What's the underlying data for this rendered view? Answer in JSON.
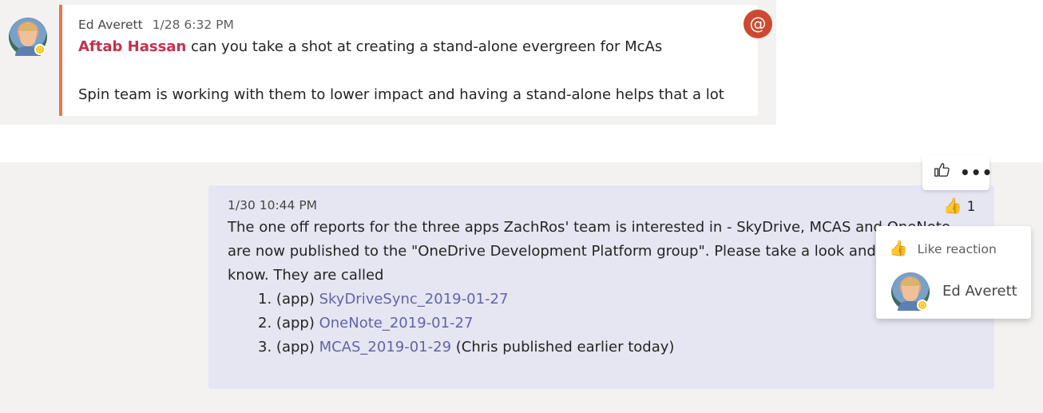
{
  "colors": {
    "accent_mention": "#c4314b",
    "message_border": "#e97548",
    "link": "#6264a7",
    "at_badge": "#cc4a31",
    "own_message_bg": "#e6e6f3",
    "presence_away": "#fcc200"
  },
  "message1": {
    "author": "Ed Averett",
    "timestamp": "1/28 6:32 PM",
    "mention": "Aftab Hassan",
    "line1_rest": " can you take a shot at creating a stand-alone evergreen for McAs",
    "line2": "Spin team is working with them to lower impact and having a stand-alone helps that a lot",
    "at_icon": "@"
  },
  "message2": {
    "timestamp": "1/30 10:44 PM",
    "lines": [
      "The one off reports for the three apps ZachRos' team is interested in - SkyDrive, MCAS and OneNote",
      "are now published to the \"OneDrive Development Platform group\". Please take a look and let me",
      "know. They are called"
    ],
    "list": [
      {
        "num": "1.",
        "prefix": "(app) ",
        "link": "SkyDriveSync_2019-01-27",
        "suffix": ""
      },
      {
        "num": "2.",
        "prefix": "(app) ",
        "link": "OneNote_2019-01-27",
        "suffix": ""
      },
      {
        "num": "3.",
        "prefix": "(app) ",
        "link": "MCAS_2019-01-29",
        "suffix": " (Chris published earlier today)"
      }
    ],
    "reaction": {
      "icon": "like-icon",
      "count": "1"
    }
  },
  "action_bar": {
    "like_icon": "like-outline-icon",
    "more_icon": "more-options-icon"
  },
  "reaction_popup": {
    "title": "Like reaction",
    "user": "Ed Averett"
  }
}
